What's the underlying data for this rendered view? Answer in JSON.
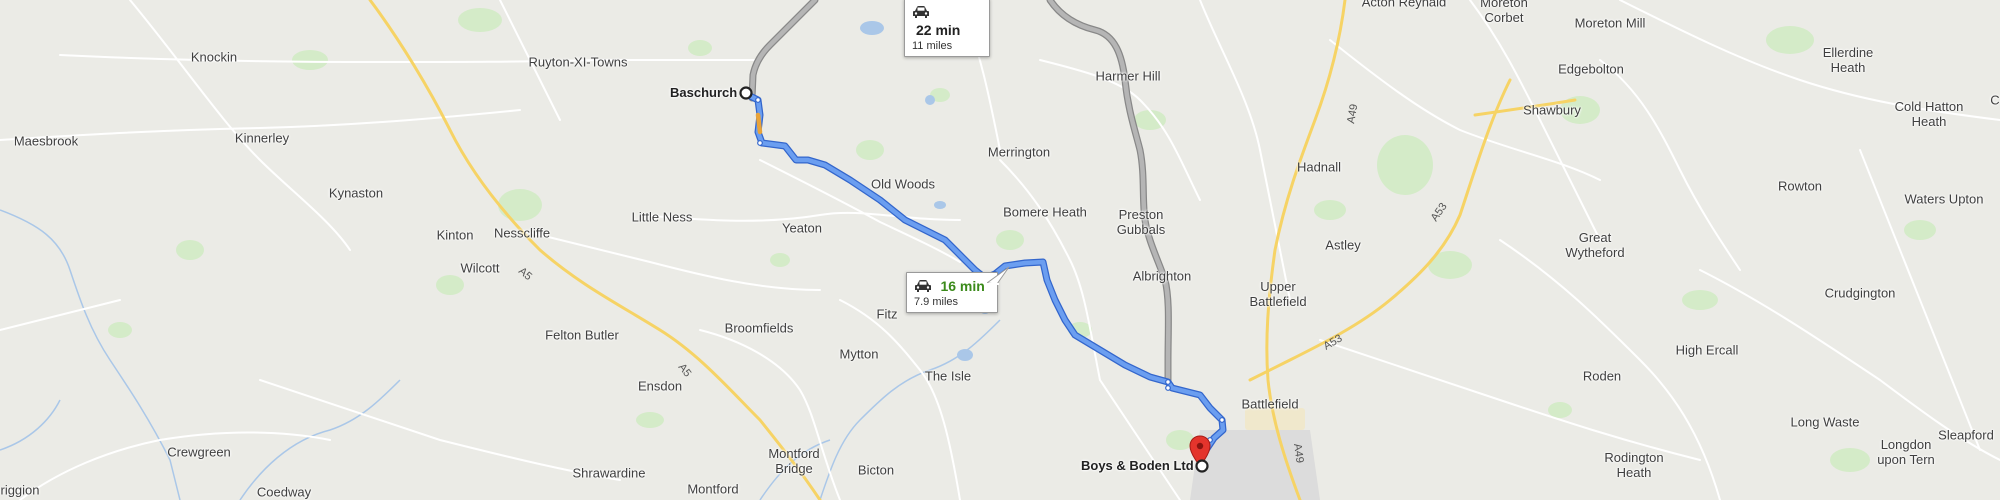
{
  "map": {
    "colors": {
      "land": "#ebebe6",
      "park": "#cfe8c2",
      "water": "#aac7e8",
      "road_minor": "#ffffff",
      "road_major": "#f9d768",
      "route_main": "#4d86e9",
      "route_alt": "#a5a5a5",
      "traffic": "#f0a03c",
      "pin": "#e4342c"
    },
    "places": [
      {
        "id": "knockin",
        "name": "Knockin"
      },
      {
        "id": "ruyton",
        "name": "Ruyton-XI-Towns"
      },
      {
        "id": "kinnerley",
        "name": "Kinnerley"
      },
      {
        "id": "maesbrook",
        "name": "Maesbrook"
      },
      {
        "id": "kynaston",
        "name": "Kynaston"
      },
      {
        "id": "kinton",
        "name": "Kinton"
      },
      {
        "id": "nesscliffe",
        "name": "Nesscliffe"
      },
      {
        "id": "wilcott",
        "name": "Wilcott"
      },
      {
        "id": "little-ness",
        "name": "Little Ness"
      },
      {
        "id": "yeaton",
        "name": "Yeaton"
      },
      {
        "id": "old-woods",
        "name": "Old Woods"
      },
      {
        "id": "merrington",
        "name": "Merrington"
      },
      {
        "id": "bomere-heath",
        "name": "Bomere Heath"
      },
      {
        "id": "harmer-hill",
        "name": "Harmer Hill"
      },
      {
        "id": "preston-gubbals",
        "name": "Preston\nGubbals"
      },
      {
        "id": "albrighton",
        "name": "Albrighton"
      },
      {
        "id": "fitz",
        "name": "Fitz"
      },
      {
        "id": "broomfields",
        "name": "Broomfields"
      },
      {
        "id": "mytton",
        "name": "Mytton"
      },
      {
        "id": "the-isle",
        "name": "The Isle"
      },
      {
        "id": "felton-butler",
        "name": "Felton Butler"
      },
      {
        "id": "ensdon",
        "name": "Ensdon"
      },
      {
        "id": "crewgreen",
        "name": "Crewgreen"
      },
      {
        "id": "coedway",
        "name": "Coedway"
      },
      {
        "id": "wriggion",
        "name": "riggion"
      },
      {
        "id": "shrawardine",
        "name": "Shrawardine"
      },
      {
        "id": "montford-bridge",
        "name": "Montford\nBridge"
      },
      {
        "id": "bicton",
        "name": "Bicton"
      },
      {
        "id": "montford",
        "name": "Montford"
      },
      {
        "id": "acton-reynald",
        "name": "Acton Reynald"
      },
      {
        "id": "moreton-corbet",
        "name": "Moreton\nCorbet"
      },
      {
        "id": "moreton-mill",
        "name": "Moreton Mill"
      },
      {
        "id": "edgebolton",
        "name": "Edgebolton"
      },
      {
        "id": "ellerdine-heath",
        "name": "Ellerdine\nHeath"
      },
      {
        "id": "shawbury",
        "name": "Shawbury"
      },
      {
        "id": "cold-hatton-heath",
        "name": "Cold Hatton\nHeath"
      },
      {
        "id": "hadnall",
        "name": "Hadnall"
      },
      {
        "id": "rowton",
        "name": "Rowton"
      },
      {
        "id": "waters-upton",
        "name": "Waters Upton"
      },
      {
        "id": "astley",
        "name": "Astley"
      },
      {
        "id": "great-wytheford",
        "name": "Great\nWytheford"
      },
      {
        "id": "upper-battlefield",
        "name": "Upper\nBattlefield"
      },
      {
        "id": "crudgington",
        "name": "Crudgington"
      },
      {
        "id": "high-ercall",
        "name": "High Ercall"
      },
      {
        "id": "roden",
        "name": "Roden"
      },
      {
        "id": "battlefield",
        "name": "Battlefield"
      },
      {
        "id": "long-waste",
        "name": "Long Waste"
      },
      {
        "id": "longdon-upon-tern",
        "name": "Longdon\nupon Tern"
      },
      {
        "id": "sleapford",
        "name": "Sleapford"
      },
      {
        "id": "rodington-heath",
        "name": "Rodington\nHeath"
      },
      {
        "id": "cut-right",
        "name": "C"
      }
    ],
    "road_labels": [
      {
        "id": "a5-upper",
        "text": "A5"
      },
      {
        "id": "a5-lower",
        "text": "A5"
      },
      {
        "id": "a49-upper",
        "text": "A49"
      },
      {
        "id": "a49-lower",
        "text": "A49"
      },
      {
        "id": "a53-upper",
        "text": "A53"
      },
      {
        "id": "a53-lower",
        "text": "A53"
      }
    ],
    "origin": {
      "label": "Baschurch"
    },
    "destination": {
      "label": "Boys & Boden Ltd"
    },
    "routes": [
      {
        "id": "route-fastest",
        "time": "16 min",
        "distance": "7.9 miles",
        "selected": true
      },
      {
        "id": "route-alt",
        "time": "22 min",
        "distance": "11 miles",
        "selected": false
      }
    ]
  }
}
